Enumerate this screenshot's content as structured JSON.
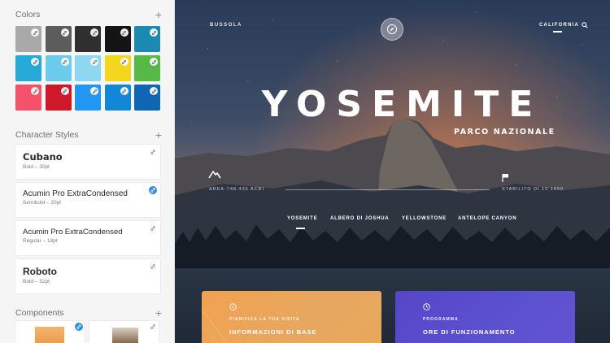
{
  "sidebar": {
    "colors": {
      "title": "Colors",
      "add": "+",
      "swatches": [
        "#a9a9a9",
        "#5c5c5c",
        "#2f2f2f",
        "#141414",
        "#1a8ab0",
        "#25a9d6",
        "#6ccbeb",
        "#8fd6f0",
        "#f2d71c",
        "#55b847",
        "#f4526a",
        "#d0182b",
        "#2196f3",
        "#1287d6",
        "#0f66b5"
      ]
    },
    "character_styles": {
      "title": "Character Styles",
      "add": "+",
      "items": [
        {
          "name": "Cubano",
          "meta": "Bold – 30pt",
          "font": "DejaVu Sans",
          "weight": "bold",
          "size": "11.5px"
        },
        {
          "name": "Acumin Pro ExtraCondensed",
          "meta": "Semibold – 20pt",
          "font": "Liberation Sans",
          "weight": "normal",
          "size": "10px"
        },
        {
          "name": "Acumin Pro ExtraCondensed",
          "meta": "Regular – 18pt",
          "font": "Liberation Sans",
          "weight": "normal",
          "size": "9.5px"
        },
        {
          "name": "Roboto",
          "meta": "Bold – 32pt",
          "font": "Liberation Sans",
          "weight": "bold",
          "size": "12px"
        }
      ]
    },
    "components": {
      "title": "Components",
      "add": "+"
    }
  },
  "canvas": {
    "brand": "BUSSOLA",
    "region": "CALIFORNIA",
    "title": "YOSEMITE",
    "subtitle": "PARCO NAZIONALE",
    "stat_left": "AREA-748.436 ACRI",
    "stat_right": "STABILITO DI 10 1890",
    "tabs": [
      "YOSEMITE",
      "ALBERO DI JOSHUA",
      "YELLOWSTONE",
      "ANTELOPE CANYON"
    ],
    "cards": [
      {
        "kicker": "PIANIFICA LA TUA VISITA",
        "title": "INFORMAZIONI DI BASE"
      },
      {
        "kicker": "PROGRAMMA",
        "title": "ORE DI FUNZIONAMENTO"
      }
    ]
  },
  "icons": {
    "link": "link-icon",
    "add": "plus-icon",
    "search": "search-icon",
    "compass": "compass-icon",
    "mountain": "mountain-icon",
    "flag": "flag-icon",
    "clock": "clock-icon"
  }
}
